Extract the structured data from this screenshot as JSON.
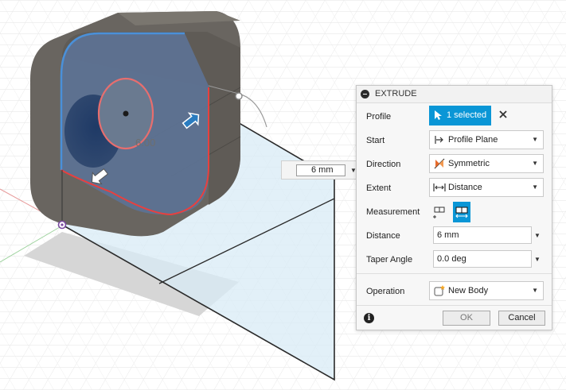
{
  "viewport": {
    "dimension_label": "6.00",
    "manipulator_value": "6 mm"
  },
  "dialog": {
    "title": "EXTRUDE",
    "profile": {
      "label": "Profile",
      "selection": "1 selected"
    },
    "start": {
      "label": "Start",
      "value": "Profile Plane"
    },
    "direction": {
      "label": "Direction",
      "value": "Symmetric"
    },
    "extent": {
      "label": "Extent",
      "value": "Distance"
    },
    "measurement": {
      "label": "Measurement"
    },
    "distance": {
      "label": "Distance",
      "value": "6 mm"
    },
    "taper": {
      "label": "Taper Angle",
      "value": "0.0 deg"
    },
    "operation": {
      "label": "Operation",
      "value": "New Body"
    },
    "ok_label": "OK",
    "cancel_label": "Cancel"
  },
  "colors": {
    "accent": "#0a96d6",
    "profile_fill": "#5b6f8e",
    "edge_highlight": "#e8403f",
    "selection_edge": "#4a90d9",
    "body": "#6a6660",
    "preview_plane": "#cfe6f2"
  }
}
